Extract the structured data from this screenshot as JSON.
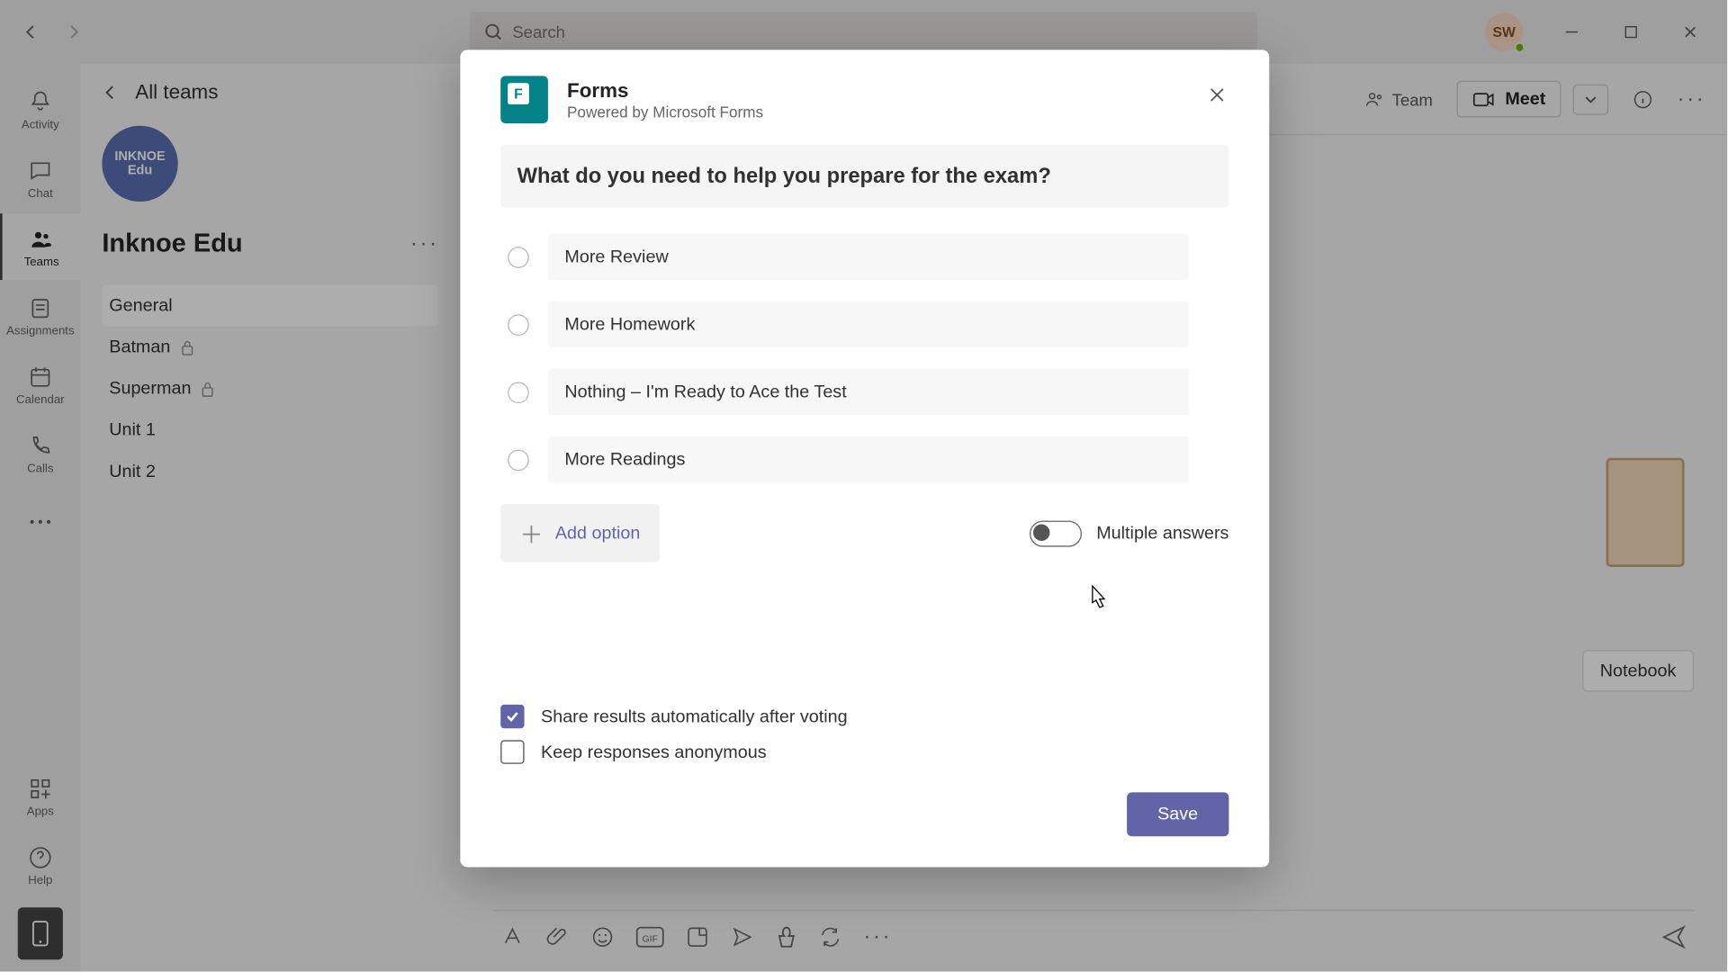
{
  "titlebar": {
    "search_placeholder": "Search",
    "avatar_initials": "SW"
  },
  "rail": {
    "items": [
      {
        "label": "Activity"
      },
      {
        "label": "Chat"
      },
      {
        "label": "Teams"
      },
      {
        "label": "Assignments"
      },
      {
        "label": "Calendar"
      },
      {
        "label": "Calls"
      }
    ],
    "apps_label": "Apps",
    "help_label": "Help"
  },
  "sidebar": {
    "all_teams": "All teams",
    "team_avatar_line1": "INKNOE",
    "team_avatar_line2": "Edu",
    "team_name": "Inknoe Edu",
    "channels": [
      {
        "label": "General",
        "locked": false,
        "active": true
      },
      {
        "label": "Batman",
        "locked": true,
        "active": false
      },
      {
        "label": "Superman",
        "locked": true,
        "active": false
      },
      {
        "label": "Unit 1",
        "locked": false,
        "active": false
      },
      {
        "label": "Unit 2",
        "locked": false,
        "active": false
      }
    ]
  },
  "header": {
    "team_btn": "Team",
    "meet_btn": "Meet"
  },
  "notebook_label": "Notebook",
  "modal": {
    "title": "Forms",
    "subtitle": "Powered by Microsoft Forms",
    "question": "What do you need to help you prepare for the exam?",
    "options": [
      "More Review",
      "More Homework",
      "Nothing – I'm Ready to Ace the Test",
      "More Readings"
    ],
    "add_option": "Add option",
    "multiple_answers": "Multiple answers",
    "share_results": "Share results automatically after voting",
    "keep_anonymous": "Keep responses anonymous",
    "save": "Save"
  }
}
